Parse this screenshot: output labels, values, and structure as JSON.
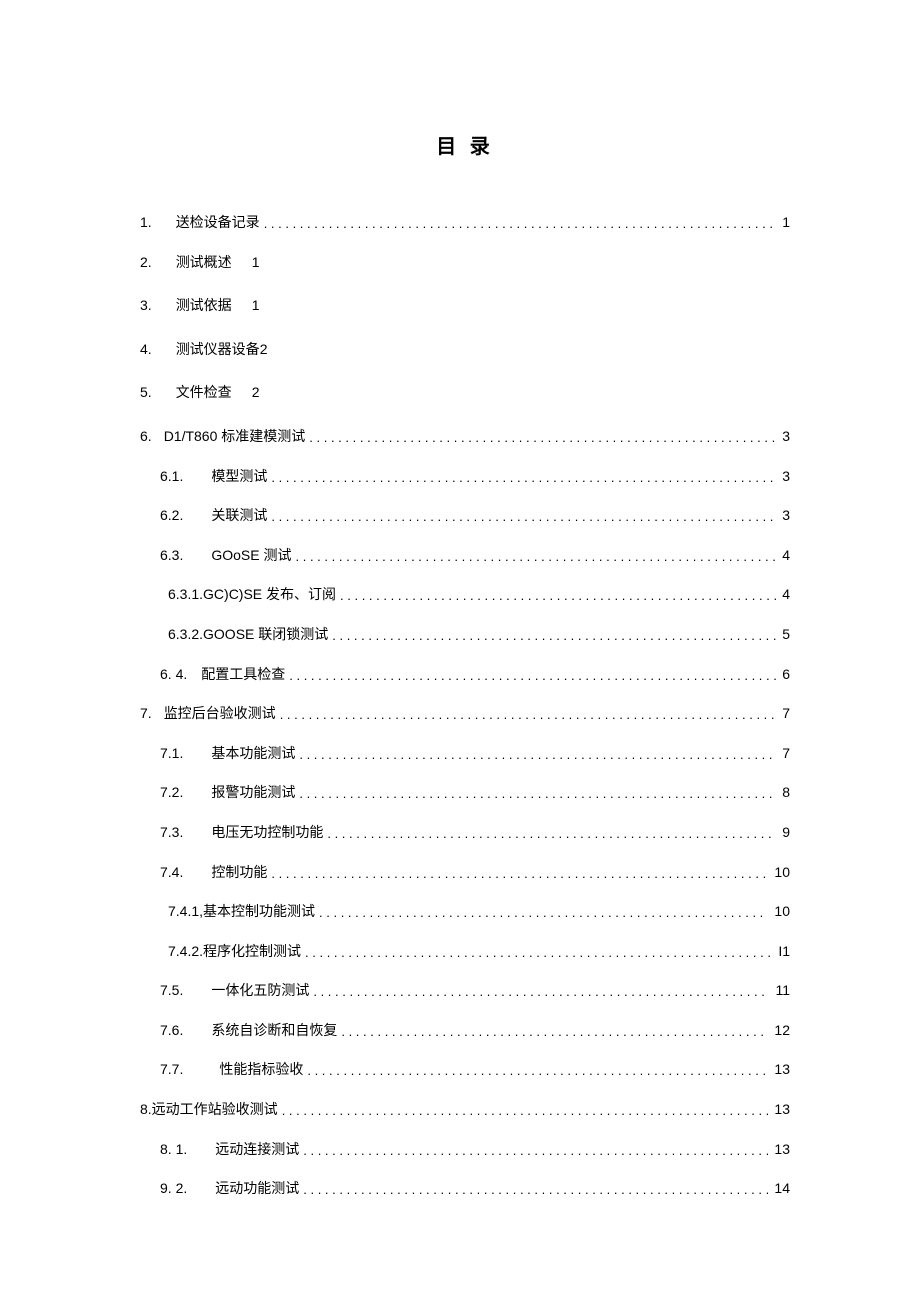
{
  "title": "目 录",
  "toc": [
    {
      "num": "1.",
      "label": "送检设备记录",
      "page": "1",
      "lvl": 0,
      "dots": true
    },
    {
      "num": "2.",
      "label": "测试概述",
      "page": "1",
      "lvl": 0,
      "dots": false
    },
    {
      "num": "3.",
      "label": "测试依据",
      "page": "1",
      "lvl": 0,
      "dots": false
    },
    {
      "num": "4.",
      "label": "测试仪器设备",
      "page": "2",
      "lvl": 0,
      "dots": false,
      "tightPage": true
    },
    {
      "num": "5.",
      "label": "文件检查",
      "page": "2",
      "lvl": 0,
      "dots": false
    },
    {
      "num": "6.",
      "label": "D1/T860 标准建模测试",
      "page": "3",
      "lvl": 0,
      "dots": true,
      "tightNum": true
    },
    {
      "num": "6.1.",
      "label": "模型测试",
      "page": "3",
      "lvl": 1,
      "dots": true
    },
    {
      "num": "6.2.",
      "label": "关联测试",
      "page": "3",
      "lvl": 1,
      "dots": true
    },
    {
      "num": "6.3.",
      "label": "GOoSE 测试",
      "page": "4",
      "lvl": 1,
      "dots": true
    },
    {
      "num": "",
      "label": "6.3.1.GC)C)SE 发布、订阅",
      "page": "4",
      "lvl": 2,
      "dots": true
    },
    {
      "num": "",
      "label": "6.3.2.GOOSE 联闭锁测试",
      "page": "5",
      "lvl": 2,
      "dots": true
    },
    {
      "num": "6.  4.",
      "label": "配置工具检查",
      "page": "6",
      "lvl": 1,
      "dots": true,
      "tightLabelGap": true
    },
    {
      "num": "7.",
      "label": "监控后台验收测试",
      "page": "7",
      "lvl": 0,
      "dots": true,
      "tightNum": true,
      "noIndent": true
    },
    {
      "num": "7.1.",
      "label": "基本功能测试",
      "page": "7",
      "lvl": 1,
      "dots": true
    },
    {
      "num": "7.2.",
      "label": "报警功能测试",
      "page": "8",
      "lvl": 1,
      "dots": true
    },
    {
      "num": "7.3.",
      "label": "电压无功控制功能",
      "page": "9",
      "lvl": 1,
      "dots": true
    },
    {
      "num": "7.4.",
      "label": "控制功能",
      "page": "10",
      "lvl": 1,
      "dots": true
    },
    {
      "num": "",
      "label": "7.4.1,基本控制功能测试",
      "page": "10",
      "lvl": 2,
      "dots": true
    },
    {
      "num": "",
      "label": "7.4.2.程序化控制测试",
      "page": "I1",
      "lvl": 2,
      "dots": true
    },
    {
      "num": "7.5.",
      "label": "一体化五防测试",
      "page": "11",
      "lvl": 1,
      "dots": true
    },
    {
      "num": "7.6.",
      "label": "系统自诊断和自恢复",
      "page": "12",
      "lvl": 1,
      "dots": true
    },
    {
      "num": "7.7.",
      "label": " 性能指标验收",
      "page": "13",
      "lvl": 1,
      "dots": true,
      "extraPadLabel": true
    },
    {
      "num": "",
      "label": "8.远动工作站验收测试",
      "page": "13",
      "lvl": 0,
      "dots": true,
      "flush": true
    },
    {
      "num": "8.  1.",
      "label": "远动连接测试",
      "page": "13",
      "lvl": 1,
      "dots": true
    },
    {
      "num": "9.  2.",
      "label": "远动功能测试",
      "page": "14",
      "lvl": 1,
      "dots": true
    }
  ]
}
